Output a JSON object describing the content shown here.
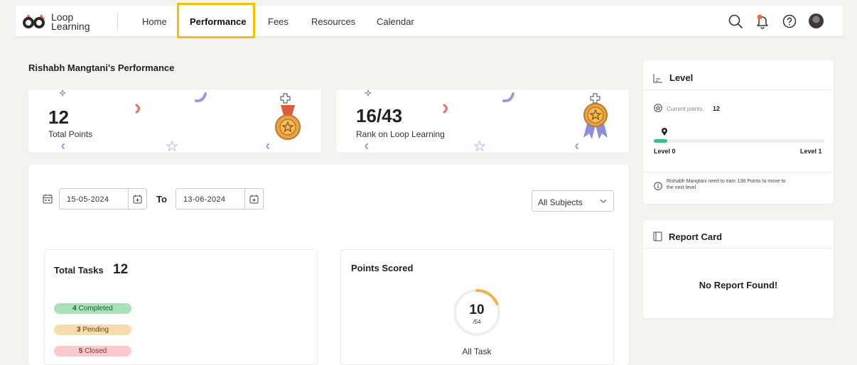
{
  "brand": {
    "name_line1": "Loop",
    "name_line2": "Learning"
  },
  "nav": {
    "items": [
      {
        "label": "Home"
      },
      {
        "label": "Performance"
      },
      {
        "label": "Fees"
      },
      {
        "label": "Resources"
      },
      {
        "label": "Calendar"
      }
    ],
    "active": "Performance"
  },
  "page": {
    "title": "Rishabh Mangtani's  Performance"
  },
  "stats": {
    "points": {
      "value": "12",
      "label": "Total Points"
    },
    "rank": {
      "value": "16/43",
      "label": "Rank on Loop Learning"
    }
  },
  "filters": {
    "from_date": "15-05-2024",
    "to_label": "To",
    "to_date": "13-06-2024",
    "subject": "All Subjects"
  },
  "tasks": {
    "title": "Total Tasks",
    "total": "12",
    "completed": {
      "count": "4",
      "label": "Completed"
    },
    "pending": {
      "count": "3",
      "label": "Pending"
    },
    "closed": {
      "count": "5",
      "label": "Closed"
    }
  },
  "points_scored": {
    "title": "Points Scored",
    "score": "10",
    "max": "/54",
    "progress": 0.185,
    "caption": "All Task"
  },
  "level": {
    "title": "Level",
    "current_label": "Current points",
    "current_points": "12",
    "from_level": "Level 0",
    "to_level": "Level 1",
    "progress": 0.08,
    "info_line1": "Rishabh Mangtani need to earn 138 Points to move to",
    "info_line2": "the next level"
  },
  "report_card": {
    "title": "Report Card",
    "empty_message": "No Report Found!"
  },
  "colors": {
    "accent": "#f5c200",
    "progress_green": "#3fbf7f",
    "completed_bg": "#a7e3b8",
    "pending_bg": "#f8dcae",
    "closed_bg": "#f9c9cc",
    "ring_track": "#eeeeee",
    "ring_fill": "#f6b04a",
    "notification_dot": "#f26b3a"
  }
}
